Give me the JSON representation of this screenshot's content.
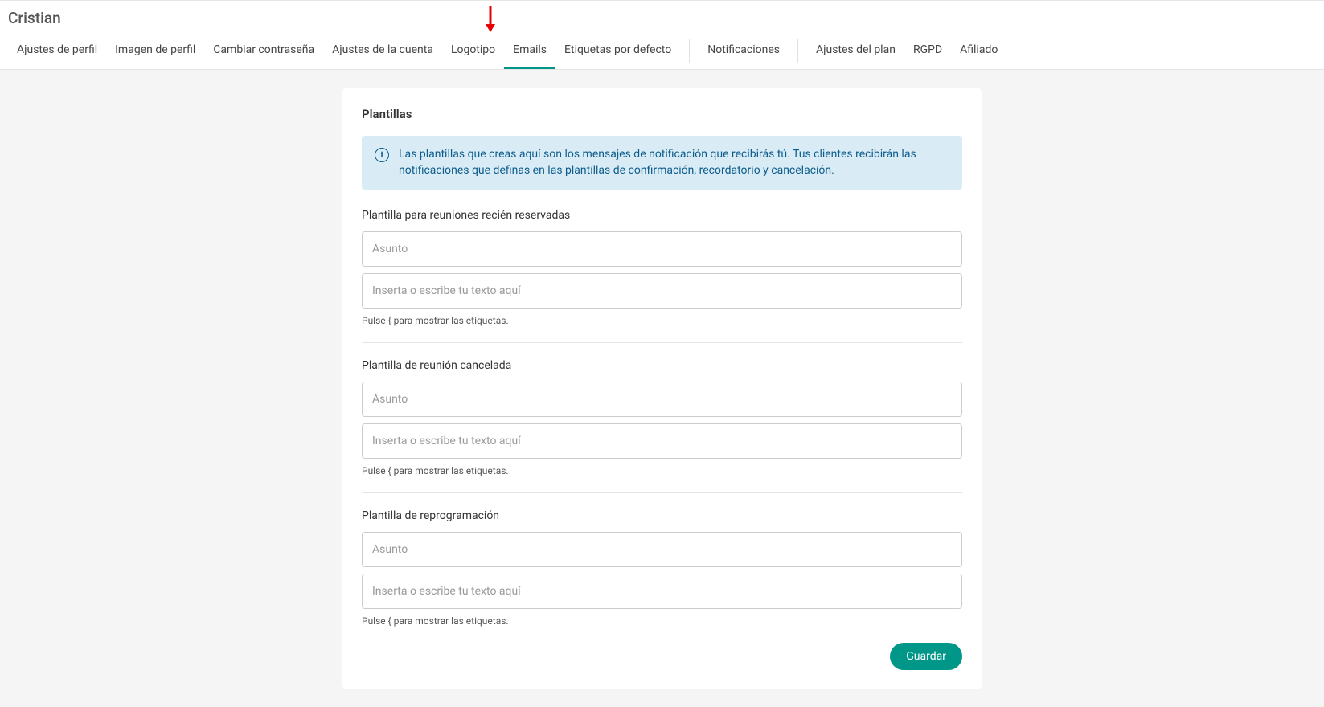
{
  "header": {
    "title": "Cristian"
  },
  "tabs": {
    "items": [
      {
        "label": "Ajustes de perfil"
      },
      {
        "label": "Imagen de perfil"
      },
      {
        "label": "Cambiar contraseña"
      },
      {
        "label": "Ajustes de la cuenta"
      },
      {
        "label": "Logotipo"
      },
      {
        "label": "Emails"
      },
      {
        "label": "Etiquetas por defecto"
      }
    ],
    "group2": [
      {
        "label": "Notificaciones"
      }
    ],
    "group3": [
      {
        "label": "Ajustes del plan"
      },
      {
        "label": "RGPD"
      },
      {
        "label": "Afiliado"
      }
    ]
  },
  "main": {
    "title": "Plantillas",
    "alert": "Las plantillas que creas aquí son los mensajes de notificación que recibirás tú. Tus clientes recibirán las notificaciones que definas en las plantillas de confirmación, recordatorio y cancelación.",
    "sections": [
      {
        "label": "Plantilla para reuniones recién reservadas",
        "subject_placeholder": "Asunto",
        "body_placeholder": "Inserta o escribe tu texto aquí",
        "helper": "Pulse { para mostrar las etiquetas."
      },
      {
        "label": "Plantilla de reunión cancelada",
        "subject_placeholder": "Asunto",
        "body_placeholder": "Inserta o escribe tu texto aquí",
        "helper": "Pulse { para mostrar las etiquetas."
      },
      {
        "label": "Plantilla de reprogramación",
        "subject_placeholder": "Asunto",
        "body_placeholder": "Inserta o escribe tu texto aquí",
        "helper": "Pulse { para mostrar las etiquetas."
      }
    ],
    "save_label": "Guardar"
  }
}
